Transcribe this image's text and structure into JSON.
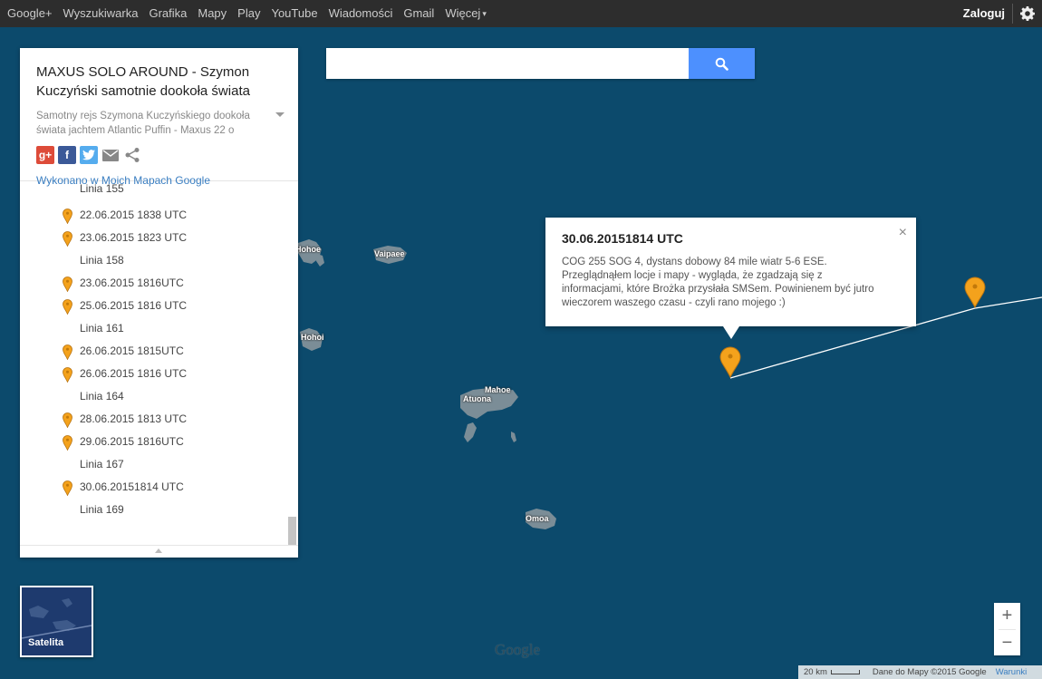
{
  "topbar": {
    "links": [
      "Google+",
      "Wyszukiwarka",
      "Grafika",
      "Mapy",
      "Play",
      "YouTube",
      "Wiadomości",
      "Gmail",
      "Więcej"
    ],
    "more_caret": "▾",
    "login": "Zaloguj"
  },
  "panel": {
    "title": "MAXUS SOLO AROUND - Szymon Kuczyński samotnie dookoła świata",
    "description": "Samotny rejs Szymona Kuczyńskiego dookoła świata jachtem Atlantic Puffin - Maxus 22 o",
    "share_icons": [
      "google-plus-icon",
      "facebook-icon",
      "twitter-icon",
      "email-icon",
      "share-icon"
    ],
    "made_with": "Wykonano w Moich Mapach Google",
    "items": [
      {
        "label": "Linia 155",
        "type": "line"
      },
      {
        "label": "22.06.2015 1838 UTC",
        "type": "point"
      },
      {
        "label": "23.06.2015 1823 UTC",
        "type": "point"
      },
      {
        "label": "Linia 158",
        "type": "line"
      },
      {
        "label": "23.06.2015 1816UTC",
        "type": "point"
      },
      {
        "label": "25.06.2015 1816 UTC",
        "type": "point"
      },
      {
        "label": "Linia 161",
        "type": "line"
      },
      {
        "label": "26.06.2015 1815UTC",
        "type": "point"
      },
      {
        "label": "26.06.2015 1816 UTC",
        "type": "point"
      },
      {
        "label": "Linia 164",
        "type": "line"
      },
      {
        "label": "28.06.2015 1813 UTC",
        "type": "point"
      },
      {
        "label": "29.06.2015 1816UTC",
        "type": "point"
      },
      {
        "label": "Linia 167",
        "type": "line"
      },
      {
        "label": "30.06.20151814 UTC",
        "type": "point"
      },
      {
        "label": "Linia 169",
        "type": "line"
      }
    ]
  },
  "search": {
    "placeholder": ""
  },
  "popup": {
    "title": "30.06.20151814 UTC",
    "body": "COG 255 SOG 4, dystans dobowy 84 mile wiatr 5-6 ESE. Przeglądnąłem locje i mapy - wygląda, że zgadzają się z informacjami, które Brożka przysłała SMSem. Powinienem być jutro wieczorem waszego czasu - czyli rano mojego :)",
    "close": "×"
  },
  "map": {
    "islands": [
      "Hohoe",
      "Vaipaee",
      "Hohoi",
      "Mahoe",
      "Atuona",
      "Omoa"
    ],
    "satellite_label": "Satelita",
    "zoom_in": "+",
    "zoom_out": "−",
    "logo": "Google",
    "scale": "20 km",
    "attribution": "Dane do Mapy ©2015 Google",
    "terms": "Warunki",
    "colors": {
      "ocean": "#0c4a6c",
      "land": "#7b8d97",
      "marker": "#f4a21c",
      "route": "#ffffff"
    }
  }
}
